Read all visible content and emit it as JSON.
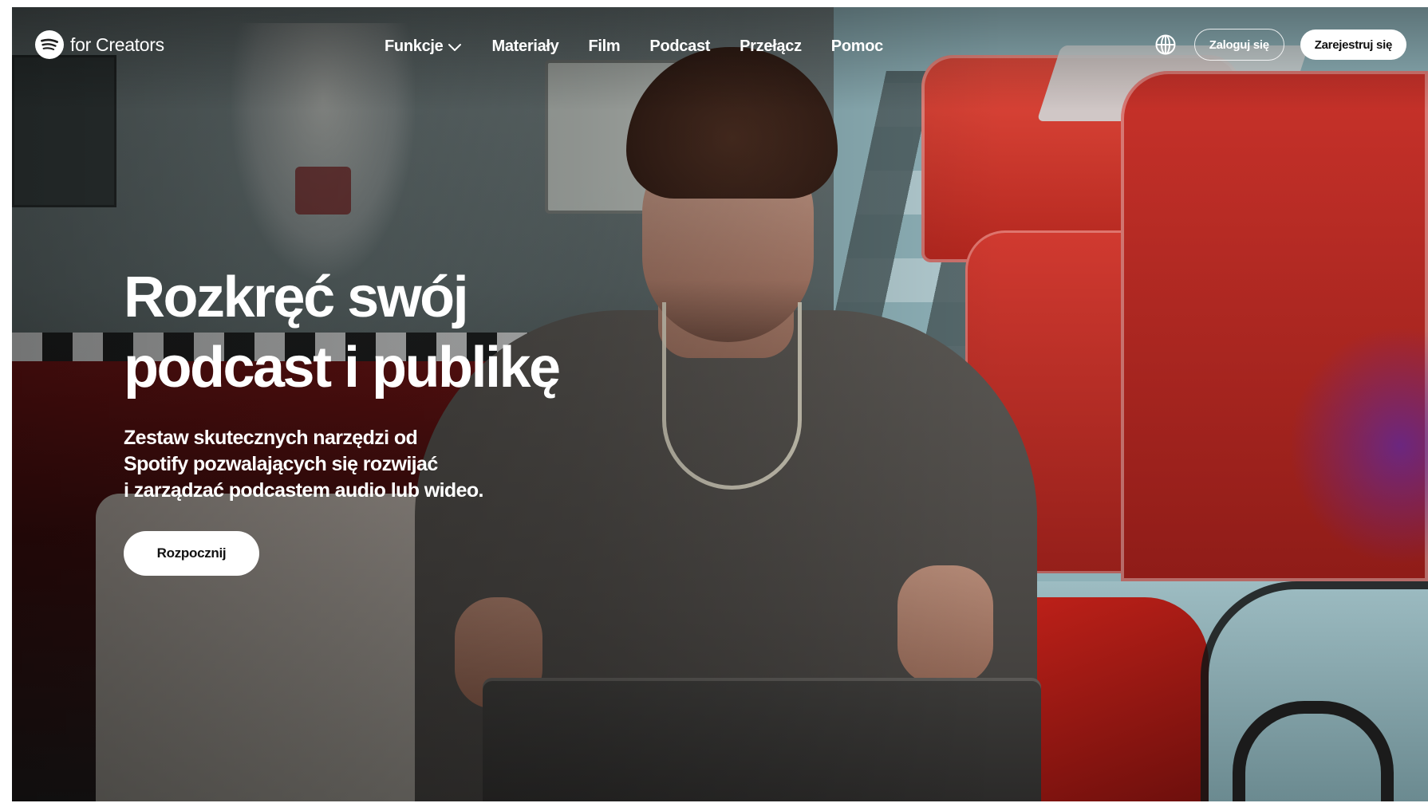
{
  "brand": {
    "logo_text": "for Creators",
    "logo_icon": "spotify-logo-icon"
  },
  "nav": {
    "items": [
      {
        "label": "Funkcje",
        "icon": "chevron-down-icon"
      },
      {
        "label": "Materiały"
      },
      {
        "label": "Film"
      },
      {
        "label": "Podcast"
      },
      {
        "label": "Przełącz"
      },
      {
        "label": "Pomoc"
      }
    ]
  },
  "actions": {
    "language_icon": "globe-icon",
    "login_label": "Zaloguj się",
    "signup_label": "Zarejestruj się"
  },
  "hero": {
    "title_line1": "Rozkręć swój",
    "title_line2": "podcast i publikę",
    "subtitle_line1": "Zestaw skutecznych narzędzi od",
    "subtitle_line2": "Spotify pozwalających się rozwijać",
    "subtitle_line3": "i zarządzać podcastem audio lub wideo.",
    "cta_label": "Rozpocznij"
  },
  "colors": {
    "text_on_dark": "#ffffff",
    "button_bg": "#ffffff",
    "button_text": "#111111"
  }
}
